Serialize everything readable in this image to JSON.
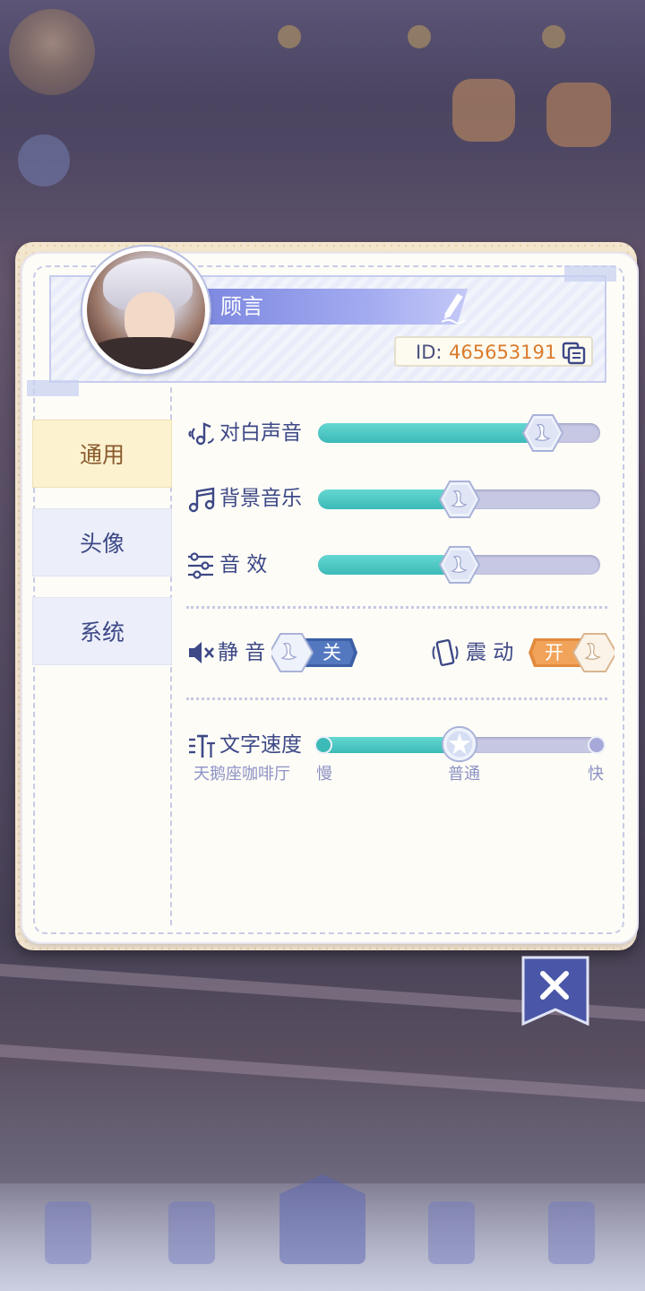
{
  "profile": {
    "name": "顾言",
    "id_label": "ID:",
    "id_value": "465653191",
    "avatar_icon": "character-portrait",
    "edit_icon": "pencil-icon",
    "copy_icon": "copy-icon"
  },
  "tabs": [
    {
      "label": "通用",
      "active": true
    },
    {
      "label": "头像",
      "active": false
    },
    {
      "label": "系统",
      "active": false
    }
  ],
  "audio": {
    "dialogue": {
      "label": "对白声音",
      "icon": "voice-note-icon",
      "level": 0.8
    },
    "bgm": {
      "label": "背景音乐",
      "icon": "music-note-icon",
      "level": 0.5
    },
    "sfx": {
      "label": "音 效",
      "icon": "sliders-icon",
      "level": 0.5
    }
  },
  "toggles": {
    "mute": {
      "label": "静 音",
      "icon": "speaker-mute-icon",
      "state_label": "关",
      "on": false
    },
    "vibrate": {
      "label": "震 动",
      "icon": "phone-vibrate-icon",
      "state_label": "开",
      "on": true
    }
  },
  "text_speed": {
    "label": "文字速度",
    "icon": "text-size-icon",
    "slow": "慢",
    "normal": "普通",
    "fast": "快",
    "value": "普通",
    "preview_text": "天鹅座咖啡厅"
  },
  "colors": {
    "accent_teal": "#3cbab8",
    "accent_purple": "#7e89e0",
    "accent_orange": "#f2a35a",
    "text_navy": "#3d4886",
    "id_orange": "#d97b2c"
  },
  "close_icon": "close-x-icon"
}
